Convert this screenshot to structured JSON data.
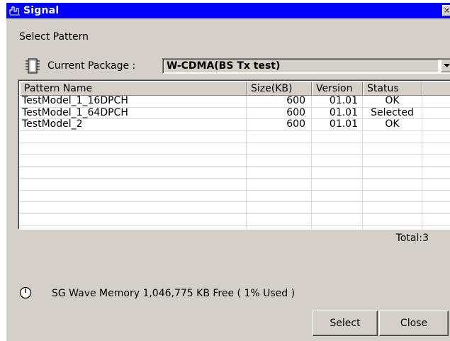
{
  "window": {
    "title": "Signal",
    "close_glyph": "×"
  },
  "section_label": "Select Pattern",
  "package": {
    "label": "Current Package :",
    "selected": "W-CDMA(BS Tx test)",
    "icon": "package-chip-icon"
  },
  "table": {
    "columns": [
      "Pattern Name",
      "Size(KB)",
      "Version",
      "Status",
      ""
    ],
    "rows": [
      {
        "name": "TestModel_1_16DPCH",
        "size": "600",
        "version": "01.01",
        "status": "OK"
      },
      {
        "name": "TestModel_1_64DPCH",
        "size": "600",
        "version": "01.01",
        "status": "Selected"
      },
      {
        "name": "TestModel_2",
        "size": "600",
        "version": "01.01",
        "status": "OK"
      },
      {
        "name": "",
        "size": "",
        "version": "",
        "status": ""
      },
      {
        "name": "",
        "size": "",
        "version": "",
        "status": ""
      },
      {
        "name": "",
        "size": "",
        "version": "",
        "status": ""
      },
      {
        "name": "",
        "size": "",
        "version": "",
        "status": ""
      },
      {
        "name": "",
        "size": "",
        "version": "",
        "status": ""
      },
      {
        "name": "",
        "size": "",
        "version": "",
        "status": ""
      },
      {
        "name": "",
        "size": "",
        "version": "",
        "status": ""
      },
      {
        "name": "",
        "size": "",
        "version": "",
        "status": ""
      },
      {
        "name": "",
        "size": "",
        "version": "",
        "status": ""
      },
      {
        "name": "",
        "size": "",
        "version": "",
        "status": ""
      },
      {
        "name": "",
        "size": "",
        "version": "",
        "status": ""
      },
      {
        "name": "",
        "size": "",
        "version": "",
        "status": ""
      },
      {
        "name": "",
        "size": "",
        "version": "",
        "status": ""
      },
      {
        "name": "",
        "size": "",
        "version": "",
        "status": ""
      }
    ]
  },
  "total": "Total:3",
  "memory": {
    "text": "SG Wave Memory 1,046,775 KB Free ( 1% Used )",
    "icon": "clock-icon"
  },
  "buttons": {
    "select": "Select",
    "close": "Close"
  },
  "colors": {
    "titlebar": "#0000ff",
    "face": "#d4d0c8"
  }
}
